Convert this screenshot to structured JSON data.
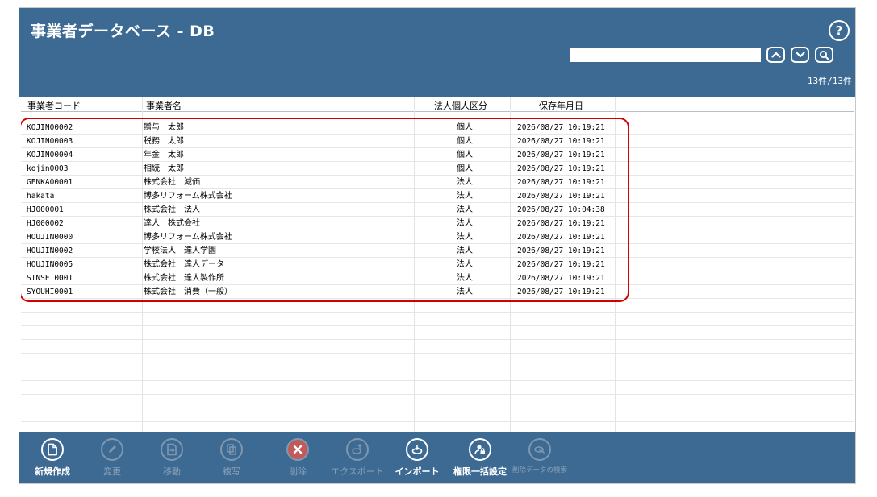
{
  "app": {
    "title": "事業者データベース - DB",
    "help": "?"
  },
  "search": {
    "value": "",
    "placeholder": ""
  },
  "record_count": "13件/13件",
  "table": {
    "headers": [
      "事業者コード",
      "事業者名",
      "法人個人区分",
      "保存年月日"
    ],
    "rows": [
      [
        "KOJIN00002",
        "贈与　太郎",
        "個人",
        "2026/08/27 10:19:21"
      ],
      [
        "KOJIN00003",
        "税務　太郎",
        "個人",
        "2026/08/27 10:19:21"
      ],
      [
        "KOJIN00004",
        "年金　太郎",
        "個人",
        "2026/08/27 10:19:21"
      ],
      [
        "kojin0003",
        "相続　太郎",
        "個人",
        "2026/08/27 10:19:21"
      ],
      [
        "GENKA00001",
        "株式会社　減価",
        "法人",
        "2026/08/27 10:19:21"
      ],
      [
        "hakata",
        "博多リフォーム株式会社",
        "法人",
        "2026/08/27 10:19:21"
      ],
      [
        "HJ000001",
        "株式会社　法人",
        "法人",
        "2026/08/27 10:04:38"
      ],
      [
        "HJ000002",
        "達人　株式会社",
        "法人",
        "2026/08/27 10:19:21"
      ],
      [
        "HOUJIN0000",
        "博多リフォーム株式会社",
        "法人",
        "2026/08/27 10:19:21"
      ],
      [
        "HOUJIN0002",
        "学校法人　達人学園",
        "法人",
        "2026/08/27 10:19:21"
      ],
      [
        "HOUJIN0005",
        "株式会社　達人データ",
        "法人",
        "2026/08/27 10:19:21"
      ],
      [
        "SINSEI0001",
        "株式会社　達人製作所",
        "法人",
        "2026/08/27 10:19:21"
      ],
      [
        "SYOUHI0001",
        "株式会社　消費（一般）",
        "法人",
        "2026/08/27 10:19:21"
      ]
    ]
  },
  "toolbar": {
    "new": "新規作成",
    "edit": "変更",
    "move": "移動",
    "copy": "複写",
    "delete": "削除",
    "export": "エクスポート",
    "import": "インポート",
    "permissions": "権限一括設定",
    "search_deleted": "削除データの検索"
  },
  "colors": {
    "header_bg": "#3d6a92",
    "highlight": "#d40000"
  },
  "icons": [
    "help-icon",
    "chevron-up-icon",
    "chevron-down-icon",
    "search-icon",
    "new-file-icon",
    "pencil-icon",
    "move-icon",
    "copy-icon",
    "delete-icon",
    "export-icon",
    "import-icon",
    "lock-user-icon",
    "search-deleted-icon"
  ]
}
